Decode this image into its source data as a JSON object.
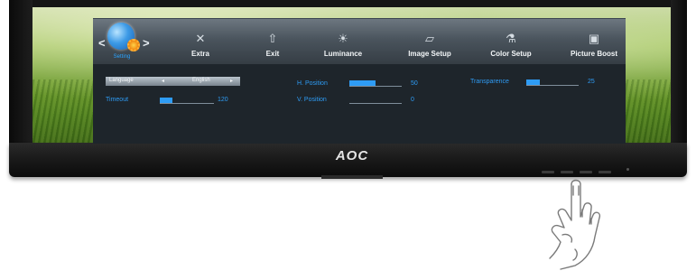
{
  "monitor": {
    "brand": "AOC"
  },
  "osd": {
    "current_menu": {
      "label": "Setting",
      "icon": "globe-gear-icon"
    },
    "nav_left": "<",
    "nav_right": ">",
    "menu": [
      {
        "label": "Extra",
        "icon": "x-icon",
        "glyph": "✕"
      },
      {
        "label": "Exit",
        "icon": "exit-icon",
        "glyph": "⇧"
      },
      {
        "label": "Luminance",
        "icon": "sun-icon",
        "glyph": "☀"
      },
      {
        "label": "Image Setup",
        "icon": "image-setup-icon",
        "glyph": "▱"
      },
      {
        "label": "Color Setup",
        "icon": "color-setup-icon",
        "glyph": "⚗"
      },
      {
        "label": "Picture Boost",
        "icon": "picture-boost-icon",
        "glyph": "▣"
      }
    ],
    "settings": {
      "language": {
        "label": "Language",
        "value": "English",
        "left_arrow": "◂",
        "right_arrow": "▸"
      },
      "timeout": {
        "label": "Timeout",
        "value": "120",
        "level": 0.24
      },
      "h_position": {
        "label": "H. Position",
        "value": "50",
        "level": 0.5
      },
      "v_position": {
        "label": "V. Position",
        "value": "0",
        "level": 0.0
      },
      "transparence": {
        "label": "Transparence",
        "value": "25",
        "level": 0.25
      }
    },
    "accent_color": "#2e9cf5"
  }
}
